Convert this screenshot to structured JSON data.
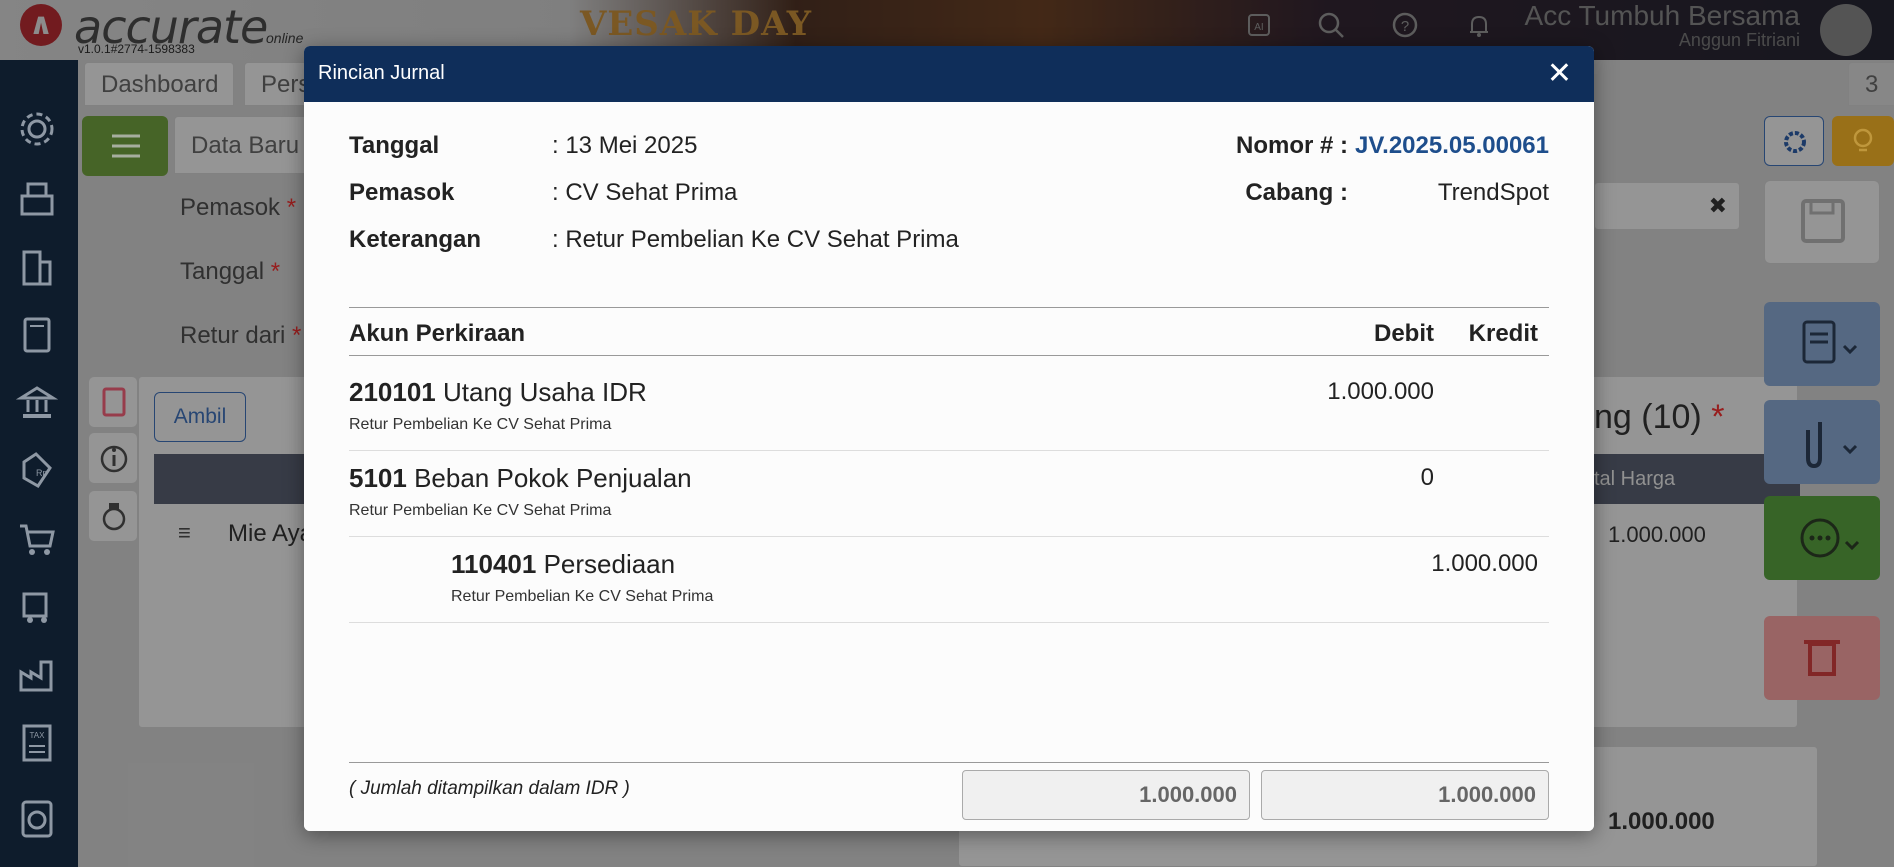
{
  "app": {
    "logo_text": "accurate",
    "logo_sub": "online",
    "version": "v1.0.1#2774-1598383",
    "banner_text": "VESAK DAY",
    "company": "Acc Tumbuh Bersama",
    "user": "Anggun Fitriani"
  },
  "background": {
    "tabs": [
      "Dashboard",
      "Pers",
      "3"
    ],
    "subtab": "Data Baru",
    "labels": [
      "Pemasok",
      "Tanggal",
      "Retur dari"
    ],
    "ambil_button": "Ambil",
    "row_item": "Mie Aya",
    "right_heading": "ng (10)",
    "column_total": "tal Harga",
    "row_amount": "1.000.000",
    "footer_total": "1.000.000"
  },
  "modal": {
    "title": "Rincian Jurnal",
    "close": "✕",
    "tanggal_label": "Tanggal",
    "tanggal_value": ": 13 Mei 2025",
    "pemasok_label": "Pemasok",
    "pemasok_value": ": CV Sehat Prima",
    "keterangan_label": "Keterangan",
    "keterangan_value": ": Retur Pembelian Ke CV Sehat Prima",
    "nomor_label": "Nomor # :",
    "nomor_value": "JV.2025.05.00061",
    "cabang_label": "Cabang :",
    "cabang_value": "TrendSpot",
    "columns": {
      "akun": "Akun Perkiraan",
      "debit": "Debit",
      "kredit": "Kredit"
    },
    "rows": [
      {
        "code": "210101",
        "name": "Utang Usaha IDR",
        "desc": "Retur Pembelian Ke CV Sehat Prima",
        "debit": "1.000.000",
        "kredit": ""
      },
      {
        "code": "5101",
        "name": "Beban Pokok Penjualan",
        "desc": "Retur Pembelian Ke CV Sehat Prima",
        "debit": "0",
        "kredit": ""
      },
      {
        "code": "110401",
        "name": "Persediaan",
        "desc": "Retur Pembelian Ke CV Sehat Prima",
        "debit": "",
        "kredit": "1.000.000"
      }
    ],
    "footnote": "( Jumlah ditampilkan dalam IDR )",
    "total_debit": "1.000.000",
    "total_kredit": "1.000.000"
  }
}
